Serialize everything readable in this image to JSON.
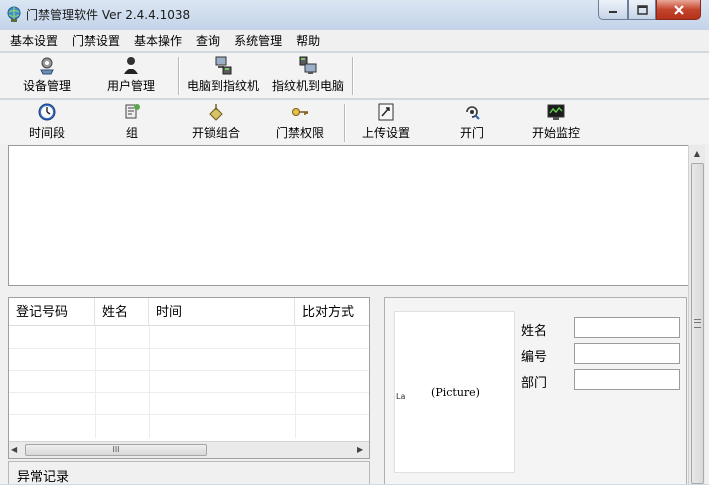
{
  "window": {
    "title": "门禁管理软件  Ver 2.4.4.1038"
  },
  "menu": [
    "基本设置",
    "门禁设置",
    "基本操作",
    "查询",
    "系统管理",
    "帮助"
  ],
  "toolbar1": [
    {
      "label": "设备管理",
      "icon": "device-gear-icon"
    },
    {
      "label": "用户管理",
      "icon": "user-icon"
    },
    {
      "label": "电脑到指纹机",
      "icon": "computer-to-device-icon"
    },
    {
      "label": "指纹机到电脑",
      "icon": "device-to-computer-icon"
    }
  ],
  "toolbar2": [
    {
      "label": "时间段",
      "icon": "clock-icon"
    },
    {
      "label": "组",
      "icon": "group-icon"
    },
    {
      "label": "开锁组合",
      "icon": "lock-combo-icon"
    },
    {
      "label": "门禁权限",
      "icon": "key-icon"
    },
    {
      "label": "上传设置",
      "icon": "upload-icon"
    },
    {
      "label": "开门",
      "icon": "open-door-icon"
    },
    {
      "label": "开始监控",
      "icon": "monitor-icon"
    }
  ],
  "records": {
    "columns": [
      "登记号码",
      "姓名",
      "时间",
      "比对方式"
    ],
    "rows": [],
    "hscroll_thumb": "III"
  },
  "abnormal": {
    "label": "异常记录"
  },
  "person": {
    "picture_placeholder": "(Picture)",
    "marker": "La",
    "fields": [
      {
        "label": "姓名",
        "value": ""
      },
      {
        "label": "编号",
        "value": ""
      },
      {
        "label": "部门",
        "value": ""
      }
    ]
  },
  "colors": {
    "titlebar": "#c3d3e8",
    "close_button": "#c4442c",
    "toolbar": "#f3f3f3"
  }
}
